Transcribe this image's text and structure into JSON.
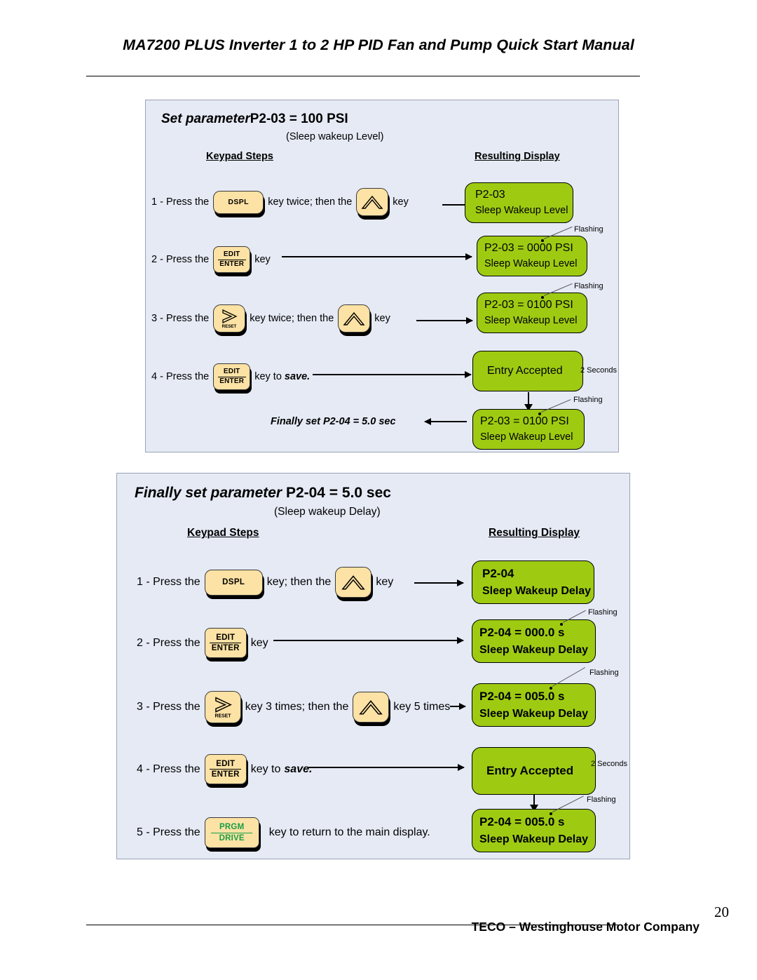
{
  "document": {
    "header_title": "MA7200 PLUS Inverter 1 to 2 HP PID Fan and Pump Quick Start Manual",
    "footer_company": "TECO – Westinghouse Motor Company",
    "page_number": "20"
  },
  "colors": {
    "panel_background": "#E5EAF5",
    "display_green": "#9ECB12",
    "key_yellow": "#FCE2A4",
    "prgm_text_green": "#179E46"
  },
  "panel1": {
    "title_italic": "Set  parameter",
    "title_plain": "P2-03 = 100 PSI",
    "subtitle": "(Sleep wakeup Level)",
    "col_keypad": "Keypad Steps",
    "col_display": "Resulting Display",
    "steps": [
      {
        "number": "1 - Press the",
        "key1": "DSPL",
        "mid": "key twice; then the",
        "key2": "up-arrow",
        "tail": "key"
      },
      {
        "number": "2 - Press the",
        "key1_top": "EDIT",
        "key1_bottom": "ENTER",
        "tail": "key"
      },
      {
        "number": "3 - Press the",
        "key1": "RESET",
        "mid": "key twice; then the",
        "key2": "up-arrow",
        "tail": "key"
      },
      {
        "number": "4 - Press the",
        "key1_top": "EDIT",
        "key1_bottom": "ENTER",
        "tail": "key to",
        "tail_italic": "save."
      }
    ],
    "displays": [
      {
        "line1": "P2-03",
        "line2": "Sleep Wakeup Level"
      },
      {
        "line1": "P2-03 = 0000 PSI",
        "line2": "Sleep Wakeup Level"
      },
      {
        "line1": "P2-03 = 0100 PSI",
        "line2": "Sleep Wakeup Level"
      },
      {
        "line1": "Entry Accepted",
        "line2": ""
      },
      {
        "line1": "P2-03 = 0100 PSI",
        "line2": "Sleep Wakeup Level"
      }
    ],
    "annotations": {
      "flashing": "Flashing",
      "two_seconds": "2 Seconds"
    },
    "final_note": "Finally set P2-04 = 5.0 sec"
  },
  "panel2": {
    "title_italic": "Finally set  parameter",
    "title_plain": "P2-04 = 5.0 sec",
    "subtitle": "(Sleep wakeup Delay)",
    "col_keypad": "Keypad Steps",
    "col_display": "Resulting Display",
    "steps": [
      {
        "number": "1 - Press the",
        "key1": "DSPL",
        "mid": "key; then the",
        "key2": "up-arrow",
        "tail": "key"
      },
      {
        "number": "2 - Press the",
        "key1_top": "EDIT",
        "key1_bottom": "ENTER",
        "tail": "key"
      },
      {
        "number": "3 - Press the",
        "key1": "RESET",
        "mid": "key 3 times; then the",
        "key2": "up-arrow",
        "tail": "key 5 times"
      },
      {
        "number": "4 - Press the",
        "key1_top": "EDIT",
        "key1_bottom": "ENTER",
        "tail": "key to",
        "tail_italic": "save."
      },
      {
        "number": "5 - Press the",
        "key1_top": "PRGM",
        "key1_bottom": "DRIVE",
        "tail": "key to return to the main display."
      }
    ],
    "displays": [
      {
        "line1": "P2-04",
        "line2": "Sleep Wakeup Delay"
      },
      {
        "line1": "P2-04 = 000.0 s",
        "line2": "Sleep Wakeup Delay"
      },
      {
        "line1": "P2-04 = 005.0 s",
        "line2": "Sleep Wakeup Delay"
      },
      {
        "line1": "Entry Accepted",
        "line2": ""
      },
      {
        "line1": "P2-04 = 005.0 s",
        "line2": "Sleep Wakeup Delay"
      }
    ],
    "annotations": {
      "flashing": "Flashing",
      "two_seconds": "2 Seconds"
    }
  }
}
